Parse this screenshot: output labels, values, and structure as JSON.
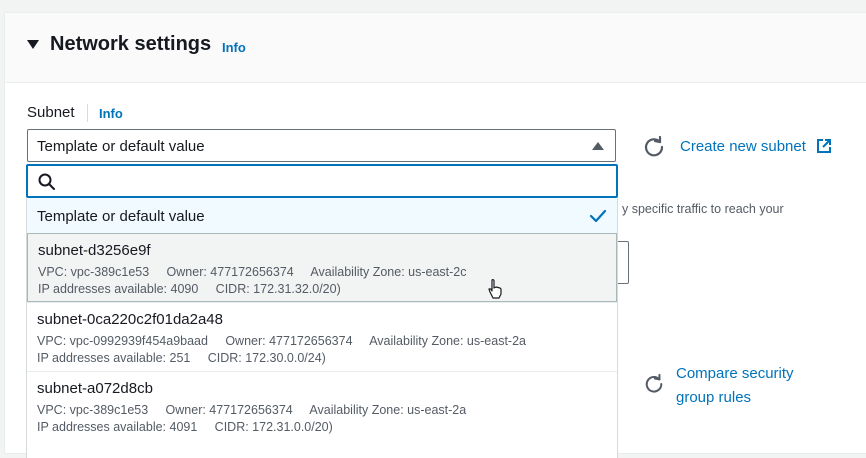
{
  "section": {
    "title": "Network settings",
    "info": "Info"
  },
  "subnet": {
    "label": "Subnet",
    "info": "Info",
    "selected_value": "Template or default value",
    "search_placeholder": "",
    "options": [
      {
        "name": "Template or default value",
        "selected": true
      },
      {
        "name": "subnet-d3256e9f",
        "line1": "VPC: vpc-389c1e53     Owner: 477172656374     Availability Zone: us-east-2c",
        "line2": "IP addresses available: 4090     CIDR: 172.31.32.0/20)",
        "hovered": true
      },
      {
        "name": "subnet-0ca220c2f01da2a48",
        "line1": "VPC: vpc-0992939f454a9baad     Owner: 477172656374     Availability Zone: us-east-2a",
        "line2": "IP addresses available: 251     CIDR: 172.30.0.0/24)"
      },
      {
        "name": "subnet-a072d8cb",
        "line1": "VPC: vpc-389c1e53     Owner: 477172656374     Availability Zone: us-east-2a",
        "line2": "IP addresses available: 4091     CIDR: 172.31.0.0/20)"
      }
    ]
  },
  "actions": {
    "create_subnet": "Create new subnet",
    "compare_rules": "Compare security group rules"
  },
  "background": {
    "partial_text": "y specific traffic to reach your"
  },
  "colors": {
    "link": "#0073bb",
    "focus_border": "#0073bb",
    "selected_bg": "#f1faff"
  }
}
